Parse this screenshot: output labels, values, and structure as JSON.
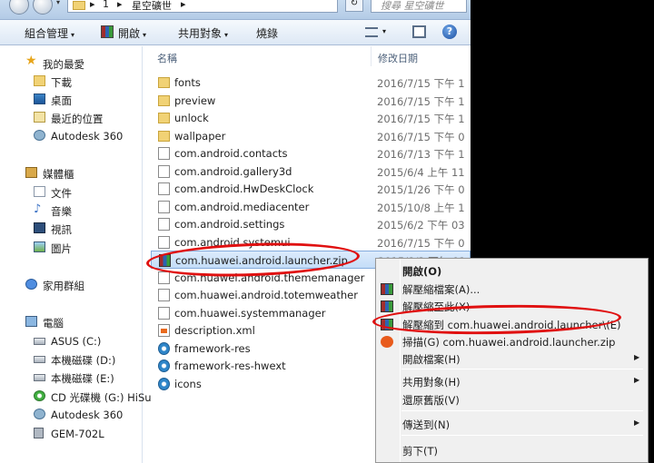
{
  "address_bar": {
    "breadcrumb": [
      "1",
      "星空礦世"
    ],
    "separator": "▸",
    "search_placeholder": "搜尋 星空礦世",
    "refresh_glyph": "↻"
  },
  "toolbar": {
    "organize": "組合管理",
    "open": "開啟",
    "share": "共用對象",
    "burn": "燒錄",
    "dropdown_glyph": "▾",
    "help_glyph": "?"
  },
  "nav": {
    "favorites": "我的最愛",
    "downloads": "下載",
    "desktop": "桌面",
    "recent": "最近的位置",
    "autodesk1": "Autodesk 360",
    "libraries": "媒體櫃",
    "documents": "文件",
    "music": "音樂",
    "videos": "視訊",
    "pictures": "圖片",
    "homegroup": "家用群組",
    "computer": "電腦",
    "asus": "ASUS (C:)",
    "disk_d": "本機磁碟 (D:)",
    "disk_e": "本機磁碟 (E:)",
    "cd_g": "CD 光碟機 (G:) HiSu",
    "autodesk2": "Autodesk 360",
    "gem": "GEM-702L"
  },
  "columns": {
    "name": "名稱",
    "date": "修改日期"
  },
  "files": [
    {
      "name": "fonts",
      "date": "2016/7/15 下午 1",
      "icon": "folder-icon"
    },
    {
      "name": "preview",
      "date": "2016/7/15 下午 1",
      "icon": "folder-icon"
    },
    {
      "name": "unlock",
      "date": "2016/7/15 下午 1",
      "icon": "folder-icon"
    },
    {
      "name": "wallpaper",
      "date": "2016/7/15 下午 0",
      "icon": "folder-icon"
    },
    {
      "name": "com.android.contacts",
      "date": "2016/7/13 下午 1",
      "icon": "file-icon"
    },
    {
      "name": "com.android.gallery3d",
      "date": "2015/6/4 上午 11",
      "icon": "file-icon"
    },
    {
      "name": "com.android.HwDeskClock",
      "date": "2015/1/26 下午 0",
      "icon": "file-icon"
    },
    {
      "name": "com.android.mediacenter",
      "date": "2015/10/8 上午 1",
      "icon": "file-icon"
    },
    {
      "name": "com.android.settings",
      "date": "2015/6/2 下午 03",
      "icon": "file-icon"
    },
    {
      "name": "com.android.systemui",
      "date": "2016/7/15 下午 0",
      "icon": "file-icon"
    },
    {
      "name": "com.huawei.android.launcher.zip",
      "date": "2015/8/2 下午 01",
      "icon": "zip-icon"
    },
    {
      "name": "com.huawei.android.thememanager",
      "date": "",
      "icon": "file-icon"
    },
    {
      "name": "com.huawei.android.totemweather",
      "date": "",
      "icon": "file-icon"
    },
    {
      "name": "com.huawei.systemmanager",
      "date": "",
      "icon": "file-icon"
    },
    {
      "name": "description.xml",
      "date": "",
      "icon": "xml-icon"
    },
    {
      "name": "framework-res",
      "date": "",
      "icon": "gear-icon"
    },
    {
      "name": "framework-res-hwext",
      "date": "",
      "icon": "gear-icon"
    },
    {
      "name": "icons",
      "date": "",
      "icon": "gear-icon"
    }
  ],
  "context_menu": {
    "open": "開啟(O)",
    "extract_files": "解壓縮檔案(A)...",
    "extract_here": "解壓縮至此(X)",
    "extract_to": "解壓縮到 com.huawei.android.launcher\\(E)",
    "scan": "掃描(G) com.huawei.android.launcher.zip",
    "open_with": "開啟檔案(H)",
    "share": "共用對象(H)",
    "restore": "還原舊版(V)",
    "send_to": "傳送到(N)",
    "cut": "剪下(T)",
    "submenu_glyph": "▶"
  },
  "colors": {
    "annotation": "#e01010",
    "selection": "#c4ddf8",
    "toolbar": "#dde8f5"
  }
}
